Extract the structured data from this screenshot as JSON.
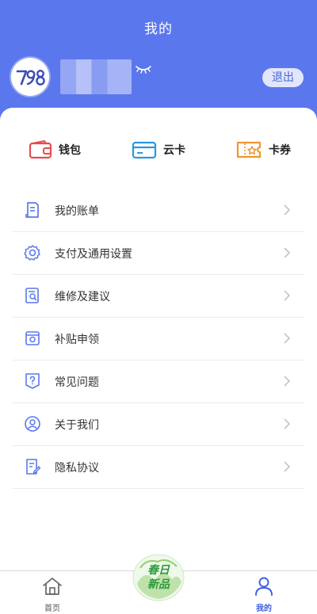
{
  "header": {
    "title": "我的",
    "logout_label": "退出",
    "background_color": "#5b77ee"
  },
  "quick_actions": [
    {
      "label": "钱包",
      "icon": "wallet-icon",
      "color": "#e94b4b"
    },
    {
      "label": "云卡",
      "icon": "card-icon",
      "color": "#2a97e4"
    },
    {
      "label": "卡券",
      "icon": "coupon-icon",
      "color": "#f0962b"
    }
  ],
  "menu": [
    {
      "label": "我的账单",
      "icon": "bill-icon"
    },
    {
      "label": "支付及通用设置",
      "icon": "gear-icon"
    },
    {
      "label": "维修及建议",
      "icon": "repair-icon"
    },
    {
      "label": "补贴申领",
      "icon": "subsidy-icon"
    },
    {
      "label": "常见问题",
      "icon": "question-icon"
    },
    {
      "label": "关于我们",
      "icon": "user-icon"
    },
    {
      "label": "隐私协议",
      "icon": "privacy-icon"
    }
  ],
  "tabbar": {
    "home_label": "首页",
    "mine_label": "我的",
    "active_color": "#3f5de0"
  }
}
